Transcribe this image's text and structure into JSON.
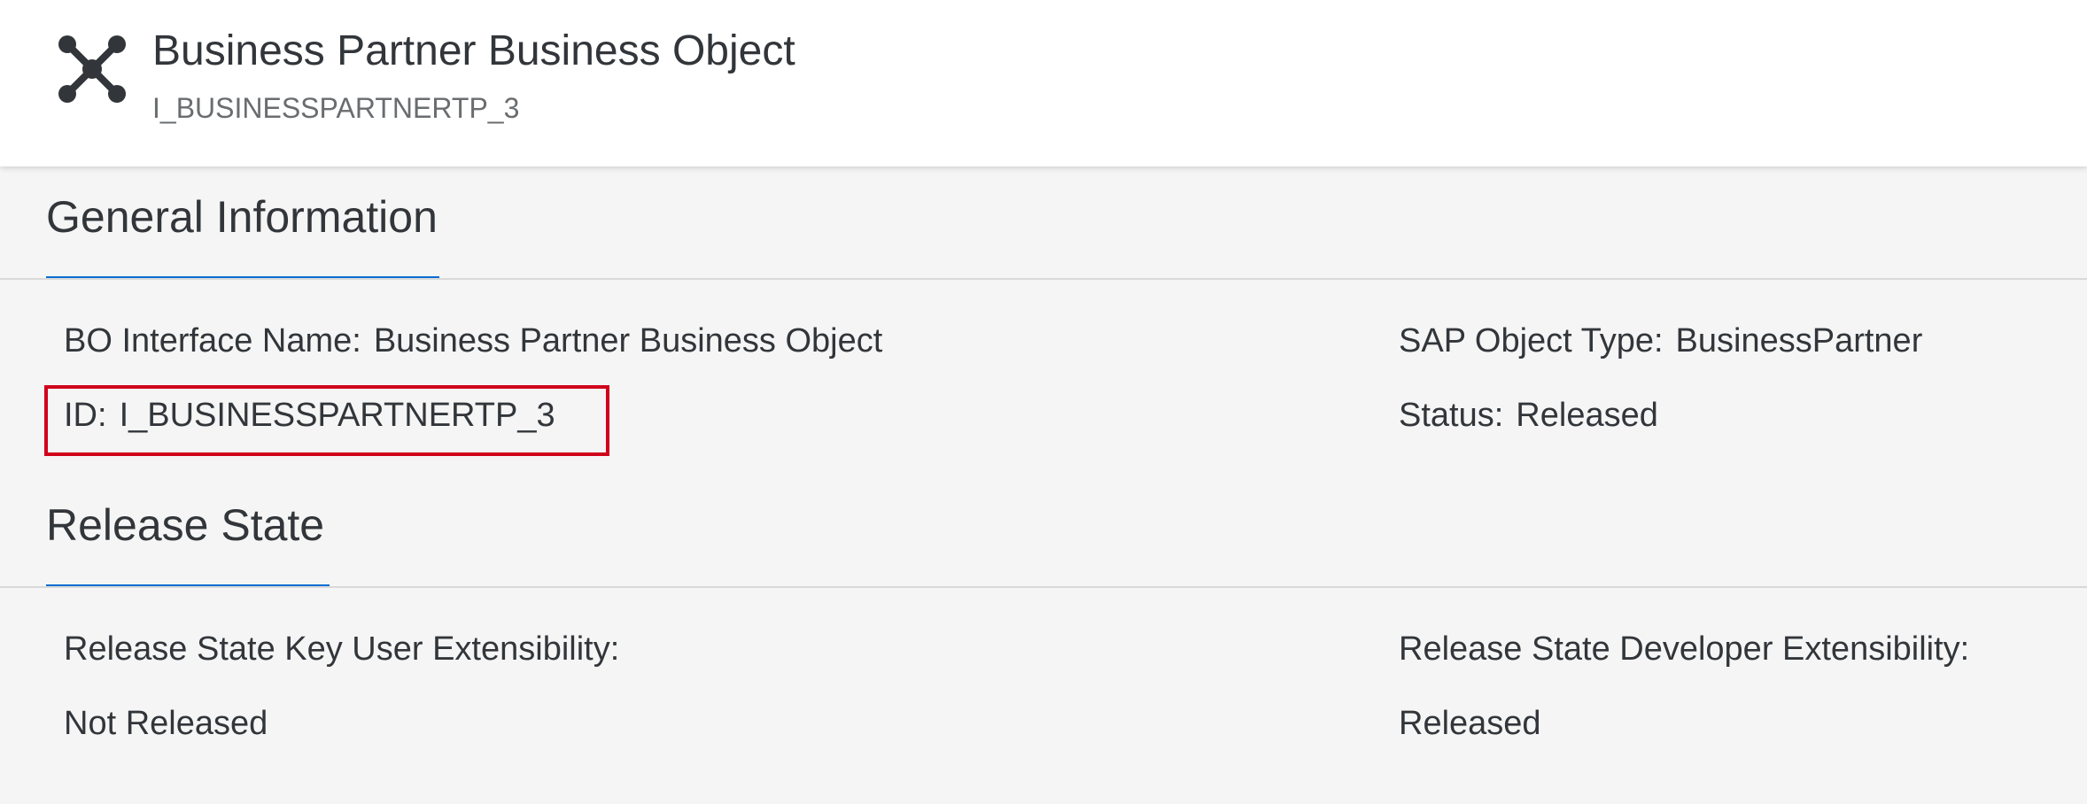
{
  "header": {
    "title": "Business Partner Business Object",
    "subtitle": "I_BUSINESSPARTNERTP_3",
    "icon": "network-nodes-icon"
  },
  "general_information": {
    "title": "General Information",
    "bo_interface_name_label": "BO Interface Name:",
    "bo_interface_name_value": "Business Partner Business Object",
    "id_label": "ID:",
    "id_value": "I_BUSINESSPARTNERTP_3",
    "sap_object_type_label": "SAP Object Type:",
    "sap_object_type_value": "BusinessPartner",
    "status_label": "Status:",
    "status_value": "Released"
  },
  "release_state": {
    "title": "Release State",
    "key_user_label": "Release State Key User Extensibility:",
    "key_user_value": "Not Released",
    "developer_label": "Release State Developer Extensibility:",
    "developer_value": "Released"
  },
  "colors": {
    "accent": "#0a6ed1",
    "highlight": "#d0021b",
    "text": "#32363a"
  }
}
